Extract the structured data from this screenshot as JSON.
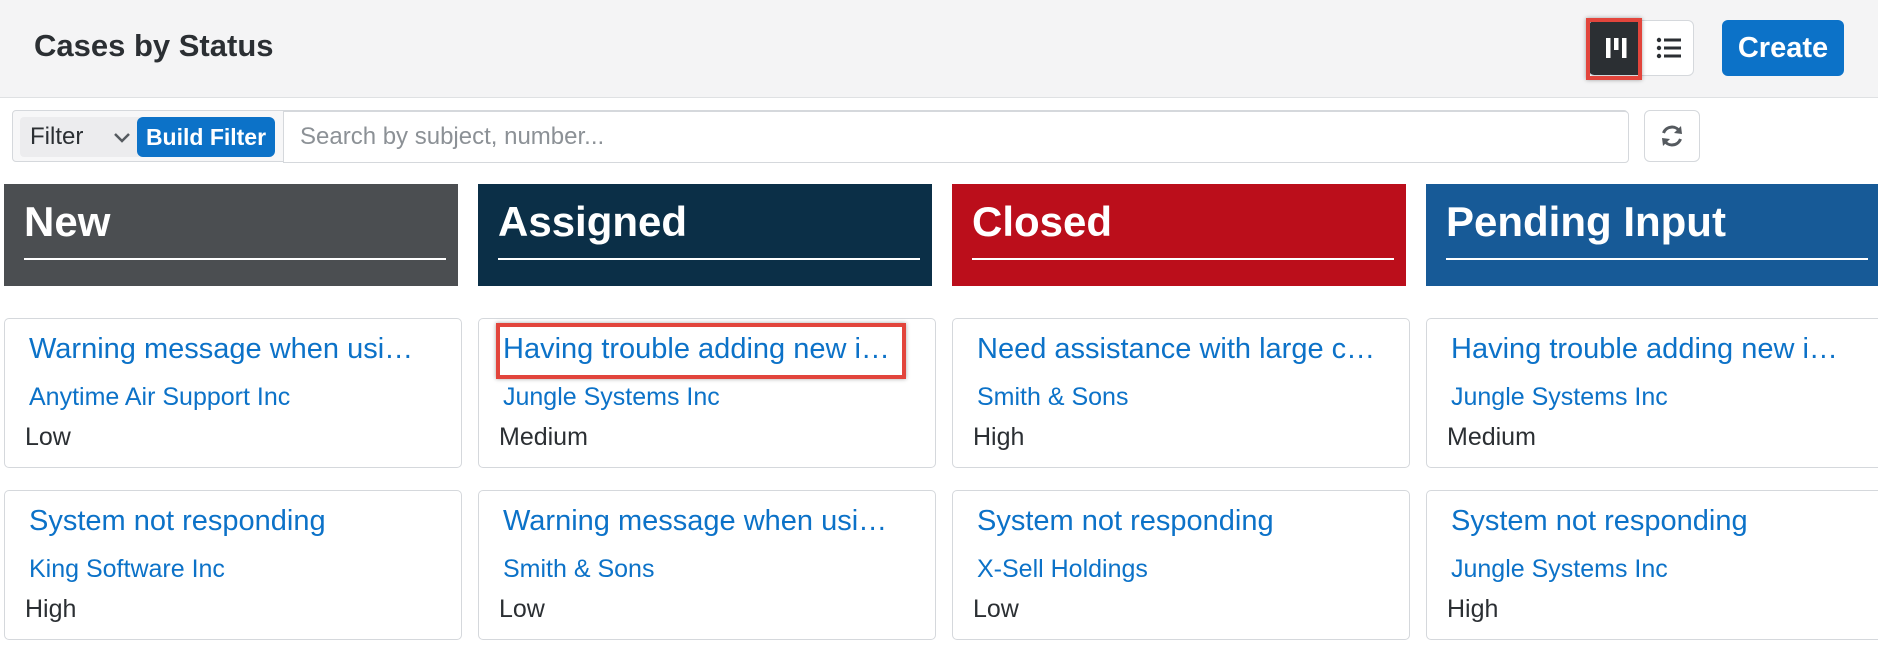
{
  "header": {
    "title": "Cases by Status",
    "create_label": "Create"
  },
  "view_toggle": {
    "active": "kanban",
    "kanban_icon": "kanban-icon",
    "list_icon": "list-icon"
  },
  "filter": {
    "dropdown_label": "Filter",
    "build_filter_label": "Build Filter",
    "search_placeholder": "Search by subject, number..."
  },
  "colors": {
    "accent": "#0c72c8",
    "new": "#4b4e51",
    "assigned": "#0b2f47",
    "closed": "#bb0e1b",
    "pending_input": "#175a97",
    "highlight": "#e2453c"
  },
  "columns": [
    {
      "title": "New",
      "cards": [
        {
          "subject": "Warning message when usi…",
          "account": "Anytime Air Support Inc",
          "priority": "Low"
        },
        {
          "subject": "System not responding",
          "account": "King Software Inc",
          "priority": "High"
        }
      ]
    },
    {
      "title": "Assigned",
      "cards": [
        {
          "subject": "Having trouble adding new i…",
          "account": "Jungle Systems Inc",
          "priority": "Medium"
        },
        {
          "subject": "Warning message when usi…",
          "account": "Smith & Sons",
          "priority": "Low"
        }
      ]
    },
    {
      "title": "Closed",
      "cards": [
        {
          "subject": "Need assistance with large c…",
          "account": "Smith & Sons",
          "priority": "High"
        },
        {
          "subject": "System not responding",
          "account": "X-Sell Holdings",
          "priority": "Low"
        }
      ]
    },
    {
      "title": "Pending Input",
      "cards": [
        {
          "subject": "Having trouble adding new i…",
          "account": "Jungle Systems Inc",
          "priority": "Medium"
        },
        {
          "subject": "System not responding",
          "account": "Jungle Systems Inc",
          "priority": "High"
        }
      ]
    }
  ]
}
